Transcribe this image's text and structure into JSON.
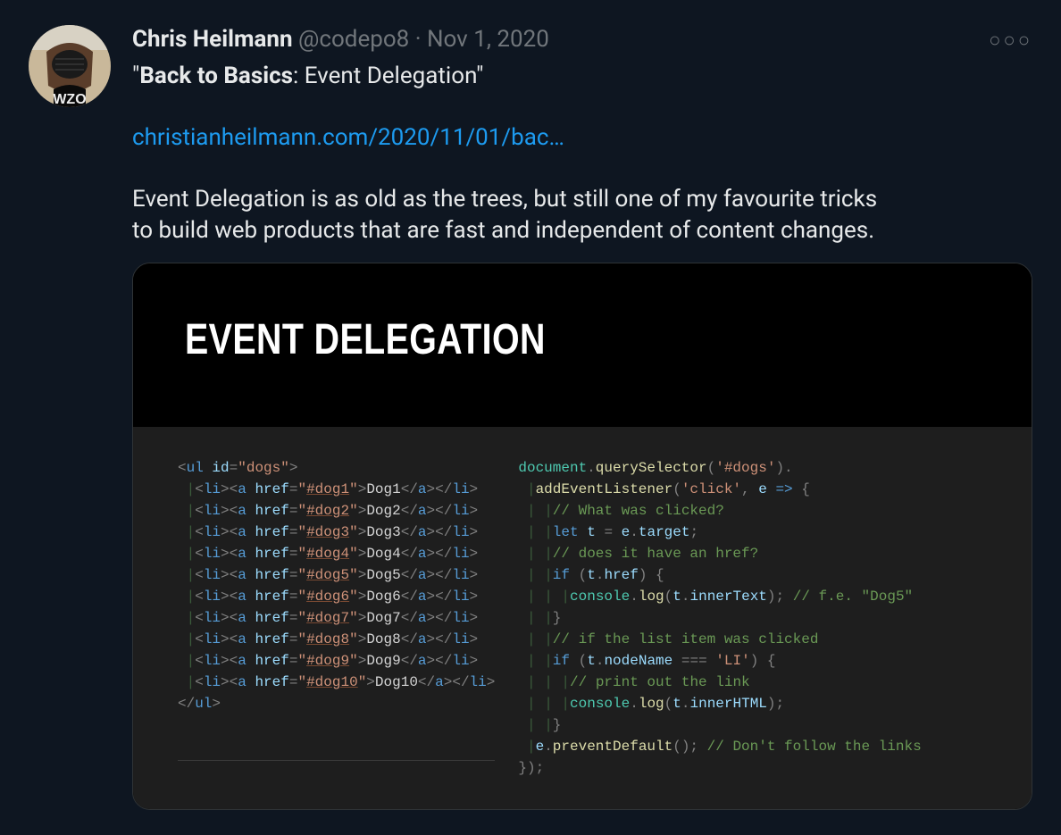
{
  "tweet": {
    "author": {
      "display_name": "Chris Heilmann",
      "handle": "@codepo8",
      "date": "Nov 1, 2020"
    },
    "title_bold": "Back to Basics",
    "title_rest": ": Event Delegation",
    "link_text": "christianheilmann.com/2020/11/01/bac…",
    "body_line1": "Event Delegation is as old as the trees, but still one of my favourite tricks",
    "body_line2": "to build web products that are fast and independent of content changes.",
    "card": {
      "heading": "EVENT DELEGATION",
      "html_list": {
        "ul_id": "dogs",
        "items": [
          {
            "href": "#dog1",
            "text": "Dog1"
          },
          {
            "href": "#dog2",
            "text": "Dog2"
          },
          {
            "href": "#dog3",
            "text": "Dog3"
          },
          {
            "href": "#dog4",
            "text": "Dog4"
          },
          {
            "href": "#dog5",
            "text": "Dog5"
          },
          {
            "href": "#dog6",
            "text": "Dog6"
          },
          {
            "href": "#dog7",
            "text": "Dog7"
          },
          {
            "href": "#dog8",
            "text": "Dog8"
          },
          {
            "href": "#dog9",
            "text": "Dog9"
          },
          {
            "href": "#dog10",
            "text": "Dog10"
          }
        ]
      },
      "js": {
        "selector": "#dogs",
        "event": "click",
        "param": "e",
        "comment_what": "// What was clicked?",
        "let_kw": "let",
        "t_var": "t",
        "target_expr": "e.target",
        "comment_href_q": "// does it have an href?",
        "if_kw": "if",
        "href_cond": "t.href",
        "log_fn": "log",
        "console": "console",
        "innerText": "innerText",
        "example_comment": "// f.e. \"Dog5\"",
        "comment_li": "// if the list item was clicked",
        "nodeName": "nodeName",
        "li_str": "'LI'",
        "comment_print": "// print out the link",
        "innerHTML": "innerHTML",
        "preventDefault": "preventDefault",
        "comment_prevent": "// Don't follow the links",
        "document": "document",
        "querySelector": "querySelector",
        "addEventListener": "addEventListener",
        "eq": "==="
      }
    }
  }
}
